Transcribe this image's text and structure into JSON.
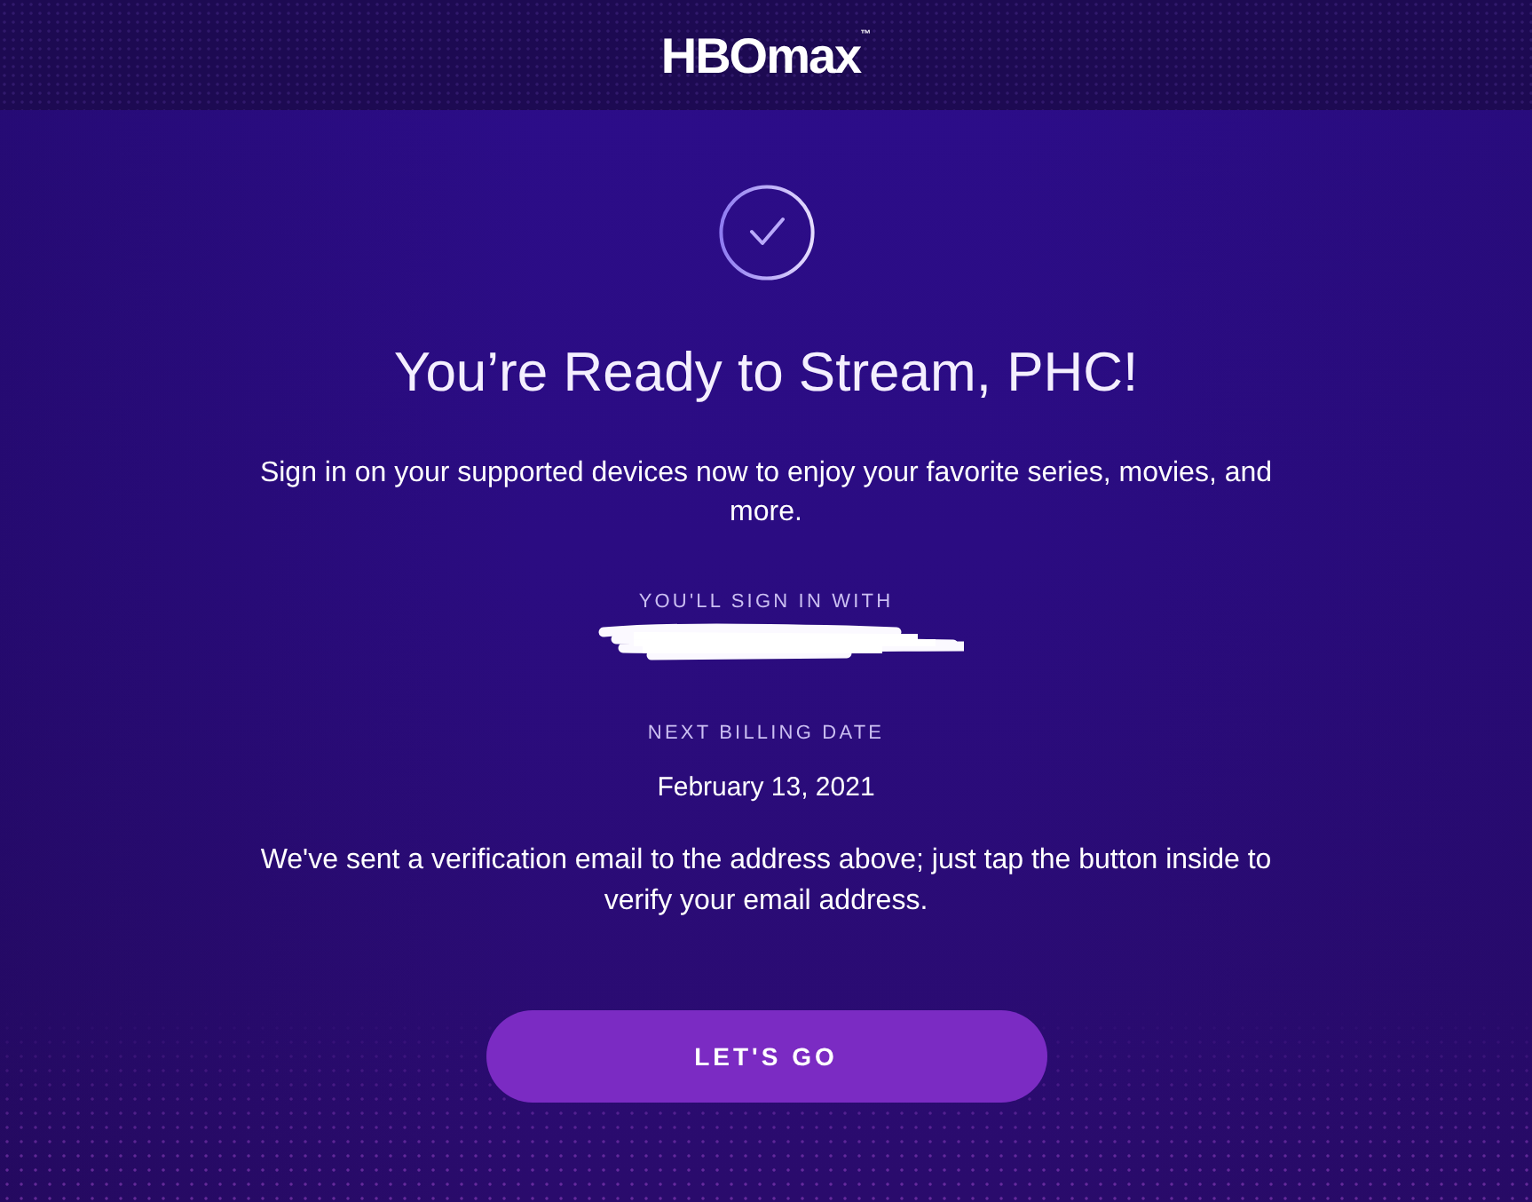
{
  "header": {
    "logo": "HBOmax$^{™}$"
  },
  "confirmation": {
    "title": "You’re Ready to Stream, PHC!",
    "message": "Sign in on your supported devices now to enjoy your favorite series, movies, and more."
  },
  "account": {
    "label": "YOU'LL SIGN IN WITH",
    "email_redacted": true
  },
  "billing": {
    "label": "NEXT BILLING DATE",
    "date": "February 13, 2021"
  },
  "note": "We've sent a verification email to the address above; just tap the button inside to verify your email address.",
  "button": {
    "label": "LET'S GO"
  }
}
